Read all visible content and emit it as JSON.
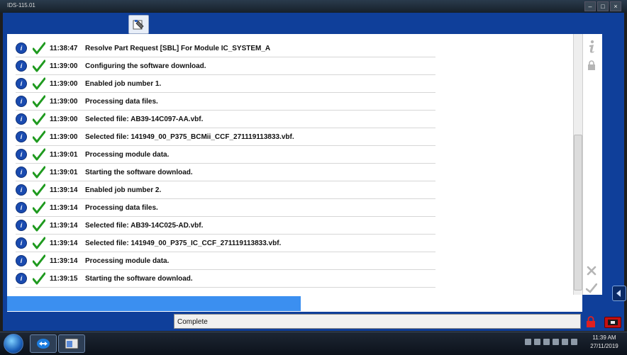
{
  "window": {
    "title": "IDS-115.01"
  },
  "log": {
    "rows": [
      {
        "time": "11:38:47",
        "message": "Resolve Part Request [SBL] For Module IC_SYSTEM_A"
      },
      {
        "time": "11:39:00",
        "message": "Configuring the software download."
      },
      {
        "time": "11:39:00",
        "message": "Enabled job number 1."
      },
      {
        "time": "11:39:00",
        "message": "Processing data files."
      },
      {
        "time": "11:39:00",
        "message": "Selected file: AB39-14C097-AA.vbf."
      },
      {
        "time": "11:39:00",
        "message": "Selected file: 141949_00_P375_BCMii_CCF_271119113833.vbf."
      },
      {
        "time": "11:39:01",
        "message": "Processing module data."
      },
      {
        "time": "11:39:01",
        "message": "Starting the software download."
      },
      {
        "time": "11:39:14",
        "message": "Enabled job number 2."
      },
      {
        "time": "11:39:14",
        "message": "Processing data files."
      },
      {
        "time": "11:39:14",
        "message": "Selected file: AB39-14C025-AD.vbf."
      },
      {
        "time": "11:39:14",
        "message": "Selected file: 141949_00_P375_IC_CCF_271119113833.vbf."
      },
      {
        "time": "11:39:14",
        "message": "Processing module data."
      },
      {
        "time": "11:39:15",
        "message": "Starting the software download."
      }
    ]
  },
  "progress": {
    "fraction": 0.51,
    "color": "#3b8ff0"
  },
  "status": {
    "text": "Complete"
  },
  "taskbar": {
    "clock_time": "11:39 AM",
    "clock_date": "27/11/2019"
  },
  "colors": {
    "header_blue": "#0f3f9a",
    "check_green": "#1f9a1f",
    "info_blue": "#1a4bb0",
    "dongle_red": "#c51010"
  }
}
